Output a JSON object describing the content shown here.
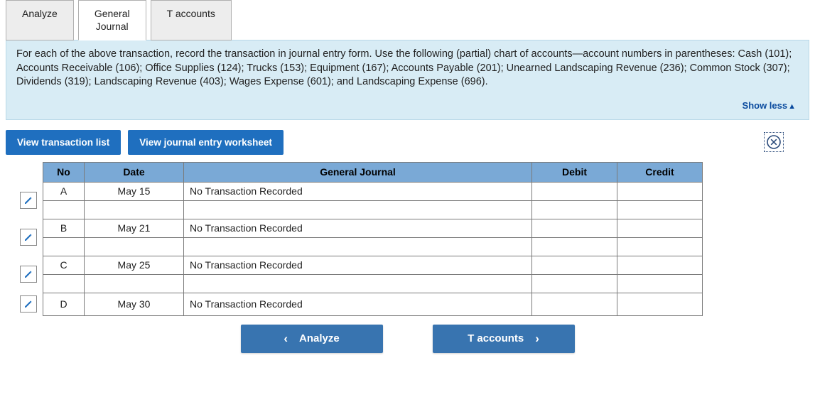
{
  "tabs": {
    "analyze": "Analyze",
    "general_journal_line1": "General",
    "general_journal_line2": "Journal",
    "t_accounts": "T accounts"
  },
  "instructions": "For each of the above transaction, record the transaction in journal entry form. Use the following (partial) chart of accounts—account numbers in parentheses: Cash (101); Accounts Receivable (106); Office Supplies (124); Trucks (153); Equipment (167); Accounts Payable (201); Unearned Landscaping Revenue (236); Common Stock (307); Dividends (319); Landscaping Revenue (403); Wages Expense (601); and Landscaping Expense (696).",
  "show_less": "Show less",
  "buttons": {
    "view_transaction_list": "View transaction list",
    "view_journal_worksheet": "View journal entry worksheet"
  },
  "table": {
    "headers": {
      "no": "No",
      "date": "Date",
      "gj": "General Journal",
      "debit": "Debit",
      "credit": "Credit"
    },
    "rows": [
      {
        "no": "A",
        "date": "May 15",
        "gj": "No Transaction Recorded",
        "debit": "",
        "credit": ""
      },
      {
        "no": "B",
        "date": "May 21",
        "gj": "No Transaction Recorded",
        "debit": "",
        "credit": ""
      },
      {
        "no": "C",
        "date": "May 25",
        "gj": "No Transaction Recorded",
        "debit": "",
        "credit": ""
      },
      {
        "no": "D",
        "date": "May 30",
        "gj": "No Transaction Recorded",
        "debit": "",
        "credit": ""
      }
    ]
  },
  "nav": {
    "prev": "Analyze",
    "next": "T accounts"
  }
}
